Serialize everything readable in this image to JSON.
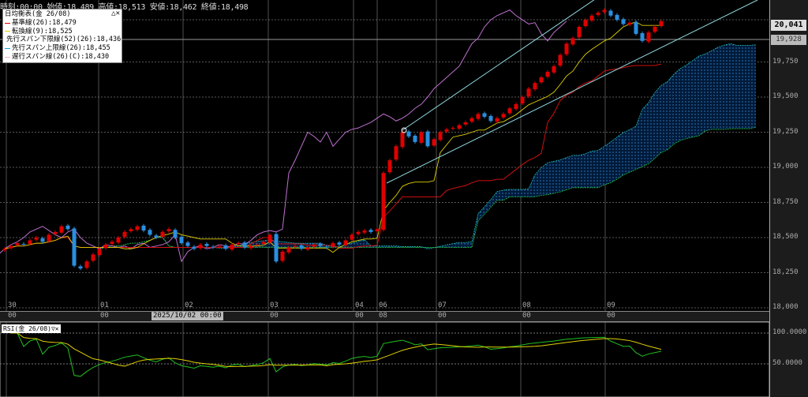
{
  "header": {
    "ohlc": "時刻:00:00 始値:18,489 高値:18,513 安値:18,462 終値:18,498"
  },
  "legend": {
    "title": "日均衡表(金 26/08)",
    "controls": "△✕",
    "items": [
      {
        "label": "基準線(26):18,479",
        "color": "#e00000"
      },
      {
        "label": "転換線(9):18,525",
        "color": "#e0d000"
      },
      {
        "label": "先行スパン下限線(52)(26):18,436",
        "color": "#20c040"
      },
      {
        "label": "先行スパン上限線(26):18,455",
        "color": "#20a0e0"
      },
      {
        "label": "遅行スパン線(26)(C):18,430",
        "color": "#f0b0d0"
      }
    ]
  },
  "price_axis": {
    "current": "20,041",
    "marker": "19,928",
    "ticks": [
      "19,750",
      "19,500",
      "19,250",
      "19,000",
      "18,750",
      "18,500",
      "18,250",
      "18,000"
    ]
  },
  "time_axis": {
    "days": [
      "30",
      "01",
      "02",
      "03",
      "04",
      "06",
      "07",
      "08",
      "09"
    ],
    "hours": [
      "00",
      "00",
      "00",
      "00",
      "00",
      "08",
      "00",
      "00",
      "00"
    ],
    "selected": "2025/10/02 00:00"
  },
  "rsi": {
    "label": "RSI(金 26/08)▽✕",
    "ticks": [
      "100.0000",
      "50.0000"
    ]
  },
  "colors": {
    "up": "#e00000",
    "down": "#2a8fe0",
    "kijun": "#d01010",
    "tenkan": "#e0d000",
    "chikou": "#c070d0",
    "trend": "#90d8e0"
  },
  "chart_data": {
    "type": "candlestick",
    "ylim": [
      18000,
      20300
    ],
    "closes": [
      18420,
      18440,
      18460,
      18450,
      18480,
      18500,
      18470,
      18520,
      18540,
      18580,
      18560,
      18300,
      18280,
      18330,
      18380,
      18420,
      18450,
      18470,
      18500,
      18540,
      18560,
      18580,
      18550,
      18520,
      18500,
      18540,
      18560,
      18500,
      18460,
      18440,
      18420,
      18450,
      18440,
      18430,
      18440,
      18420,
      18450,
      18460,
      18430,
      18440,
      18450,
      18470,
      18520,
      18330,
      18400,
      18430,
      18440,
      18420,
      18430,
      18450,
      18440,
      18430,
      18460,
      18450,
      18480,
      18520,
      18540,
      18550,
      18540,
      18560,
      18960,
      19050,
      19150,
      19250,
      19220,
      19180,
      19250,
      19150,
      19200,
      19250,
      19270,
      19280,
      19300,
      19320,
      19350,
      19380,
      19360,
      19330,
      19350,
      19380,
      19420,
      19450,
      19500,
      19560,
      19600,
      19640,
      19680,
      19720,
      19800,
      19880,
      19920,
      20000,
      20050,
      20080,
      20100,
      20120,
      20080,
      20050,
      20020,
      20030,
      19950,
      19900,
      19960,
      20000,
      20041
    ]
  }
}
